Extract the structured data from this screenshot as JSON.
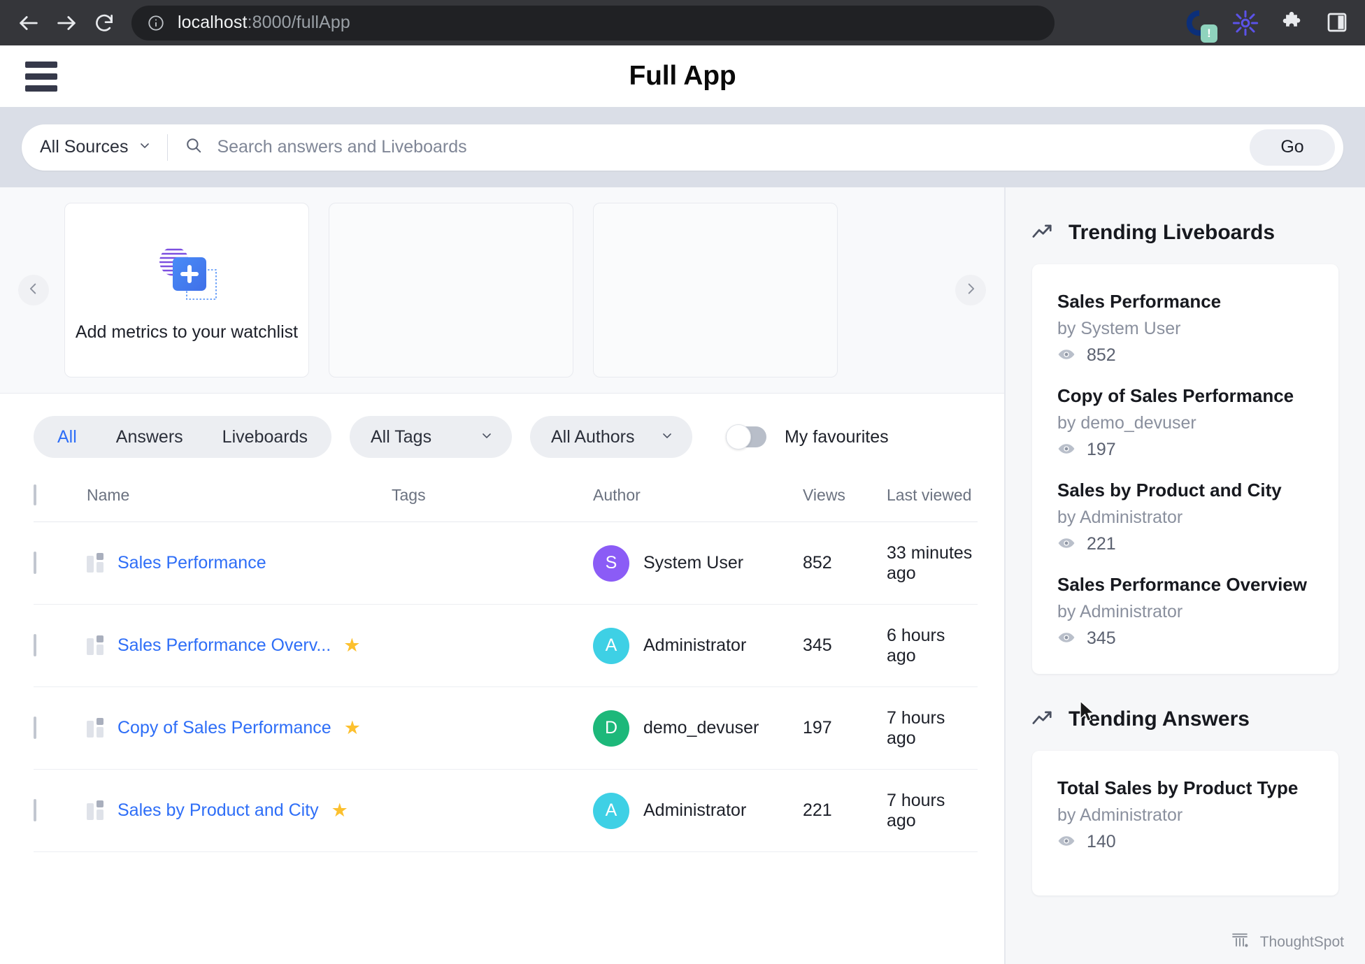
{
  "browser": {
    "back_icon": "back-arrow-icon",
    "forward_icon": "forward-arrow-icon",
    "reload_icon": "reload-icon",
    "site_info_icon": "site-info-icon",
    "url_host": "localhost",
    "url_rest": ":8000/fullApp",
    "extensions": [
      {
        "name": "thoughtspot-extension-icon",
        "badge": "!"
      },
      {
        "name": "asterisk-extension-icon",
        "badge": ""
      },
      {
        "name": "puzzle-extensions-icon",
        "badge": ""
      },
      {
        "name": "sidepanel-icon",
        "badge": ""
      }
    ]
  },
  "app_header": {
    "menu_icon": "hamburger-menu-icon",
    "title": "Full App"
  },
  "search": {
    "source_label": "All Sources",
    "source_caret_icon": "chevron-down-icon",
    "search_icon": "search-icon",
    "placeholder": "Search answers and Liveboards",
    "value": "",
    "go_label": "Go"
  },
  "watchlist": {
    "prev_icon": "chevron-left-icon",
    "next_icon": "chevron-right-icon",
    "add_card_label": "Add metrics to your watchlist",
    "add_icon": "add-metric-icon",
    "empty_cards": 2
  },
  "filters": {
    "segments": [
      {
        "label": "All",
        "active": true
      },
      {
        "label": "Answers",
        "active": false
      },
      {
        "label": "Liveboards",
        "active": false
      }
    ],
    "tags_label": "All Tags",
    "authors_label": "All Authors",
    "favourites_label": "My favourites",
    "favourites_on": false,
    "caret_icon": "chevron-down-icon"
  },
  "table": {
    "columns": [
      "Name",
      "Tags",
      "Author",
      "Views",
      "Last viewed"
    ],
    "select_all_checked": false,
    "rows": [
      {
        "name": "Sales Performance",
        "favourite": false,
        "tags": "",
        "author": "System User",
        "author_initial": "S",
        "avatar_color": "#8b5cf6",
        "views": "852",
        "last_viewed": "33 minutes ago",
        "type_icon": "liveboard-icon"
      },
      {
        "name": "Sales Performance Overv...",
        "favourite": true,
        "tags": "",
        "author": "Administrator",
        "author_initial": "A",
        "avatar_color": "#3ed0e5",
        "views": "345",
        "last_viewed": "6 hours ago",
        "type_icon": "liveboard-icon"
      },
      {
        "name": "Copy of Sales Performance",
        "favourite": true,
        "tags": "",
        "author": "demo_devuser",
        "author_initial": "D",
        "avatar_color": "#1db87a",
        "views": "197",
        "last_viewed": "7 hours ago",
        "type_icon": "liveboard-icon"
      },
      {
        "name": "Sales by Product and City",
        "favourite": true,
        "tags": "",
        "author": "Administrator",
        "author_initial": "A",
        "avatar_color": "#3ed0e5",
        "views": "221",
        "last_viewed": "7 hours ago",
        "type_icon": "liveboard-icon"
      }
    ]
  },
  "sidebar": {
    "trending_liveboards": {
      "title": "Trending Liveboards",
      "icon": "trending-up-icon",
      "items": [
        {
          "title": "Sales Performance",
          "author": "by System User",
          "views": "852",
          "views_icon": "eye-icon"
        },
        {
          "title": "Copy of Sales Performance",
          "author": "by demo_devuser",
          "views": "197",
          "views_icon": "eye-icon"
        },
        {
          "title": "Sales by Product and City",
          "author": "by Administrator",
          "views": "221",
          "views_icon": "eye-icon"
        },
        {
          "title": "Sales Performance Overview",
          "author": "by Administrator",
          "views": "345",
          "views_icon": "eye-icon"
        }
      ]
    },
    "trending_answers": {
      "title": "Trending Answers",
      "icon": "trending-up-icon",
      "items": [
        {
          "title": "Total Sales by Product Type",
          "author": "by Administrator",
          "views": "140",
          "views_icon": "eye-icon"
        }
      ]
    }
  },
  "footer": {
    "brand": "ThoughtSpot",
    "brand_icon": "thoughtspot-logo-icon"
  },
  "colors": {
    "link": "#2e6ef7",
    "accent": "#2e6ef7",
    "star": "#fcc02e",
    "search_band": "#dadee7",
    "chrome": "#35363a"
  }
}
